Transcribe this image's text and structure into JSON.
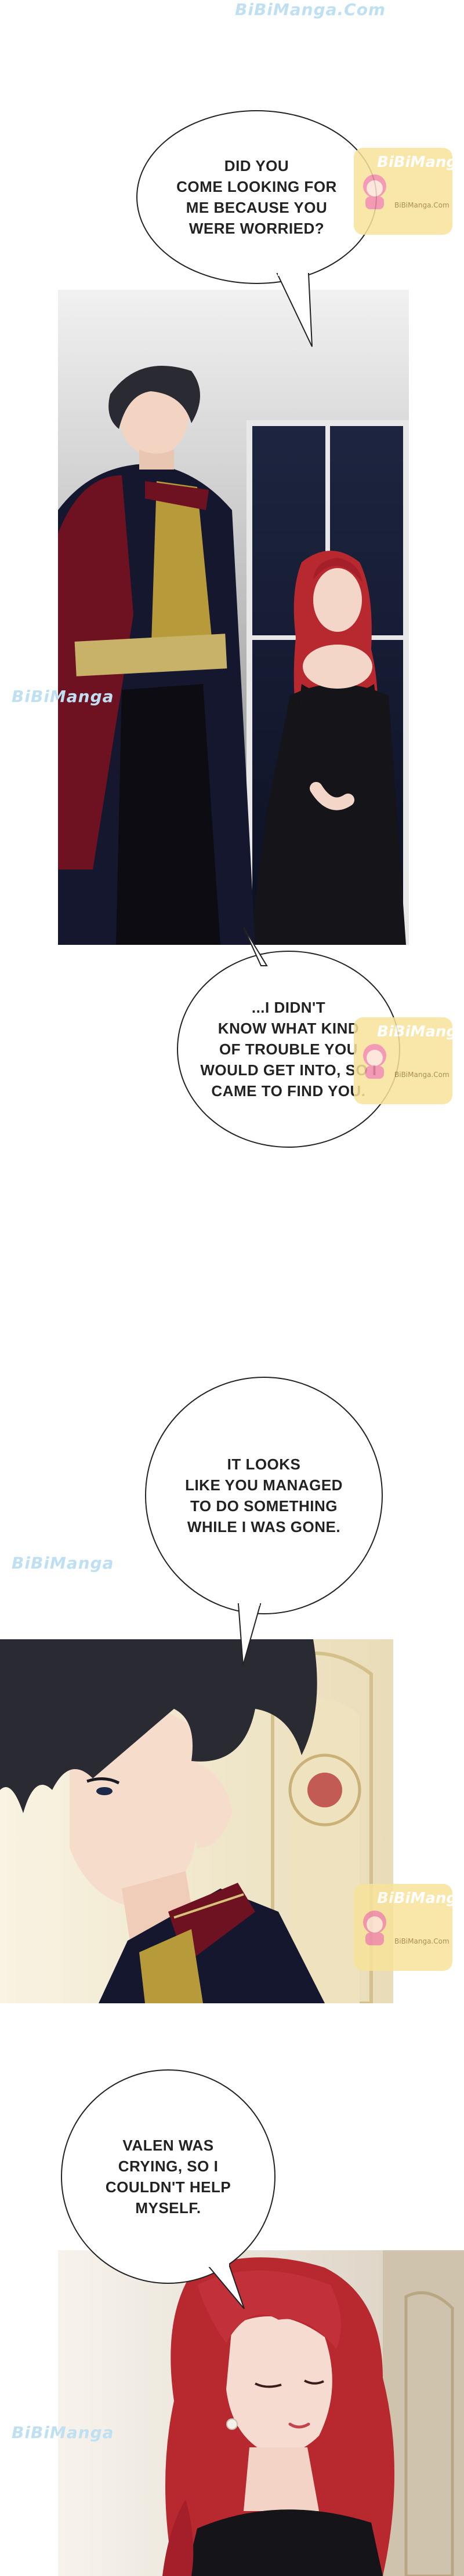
{
  "watermark": {
    "site_text": "BiBiManga.Com",
    "side_text": "BiBiManga",
    "badge_title": "BiBiManga",
    "badge_sub": "BiBiManga.Com"
  },
  "bubbles": [
    {
      "text": "DID YOU\nCOME LOOKING FOR\nME BECAUSE YOU\nWERE WORRIED?"
    },
    {
      "text": "...I DIDN'T\nKNOW WHAT KIND\nOF TROUBLE YOU\nWOULD GET INTO, SO I\nCAME TO FIND YOU."
    },
    {
      "text": "IT LOOKS\nLIKE YOU MANAGED\nTO DO SOMETHING\nWHILE I WAS GONE."
    },
    {
      "text": "VALEN WAS\nCRYING, SO I\nCOULDN'T HELP\nMYSELF."
    }
  ],
  "colors": {
    "uniform_red": "#6e1222",
    "uniform_navy": "#15172e",
    "gold": "#b79a3a",
    "hair_dark": "#2a2a33",
    "hair_red": "#b8282f",
    "dress_black": "#141419"
  }
}
